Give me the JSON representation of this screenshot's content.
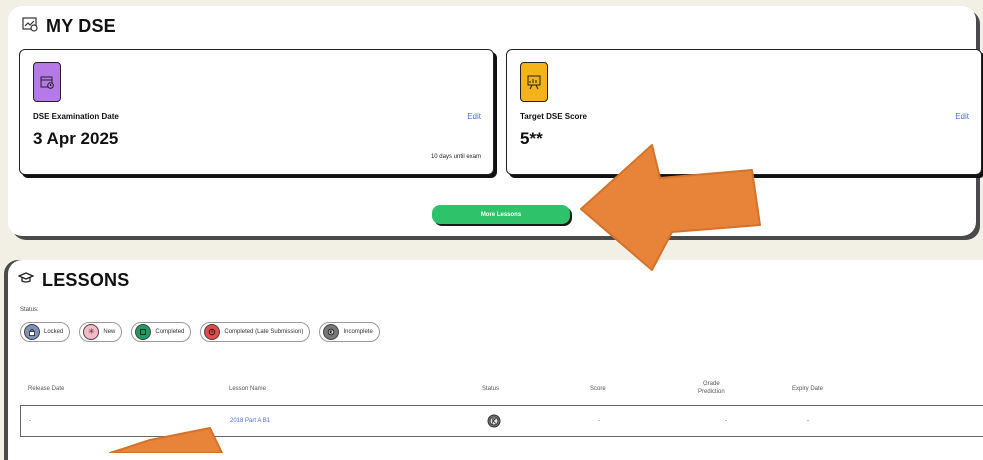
{
  "dse": {
    "title": "MY DSE",
    "exam_card": {
      "label": "DSE Examination Date",
      "value": "3 Apr 2025",
      "edit": "Edit",
      "note": "10 days until exam"
    },
    "target_card": {
      "label": "Target DSE Score",
      "value": "5**",
      "edit": "Edit"
    },
    "more_button": "More Lessons"
  },
  "lessons": {
    "title": "LESSONS",
    "status_label": "Status:",
    "legend": [
      {
        "label": "Locked",
        "color": "#7f8fb8",
        "icon": "lock-icon"
      },
      {
        "label": "New",
        "color": "#f7b8c8",
        "icon": "sun-icon"
      },
      {
        "label": "Completed",
        "color": "#1f9c62",
        "icon": "check-icon"
      },
      {
        "label": "Completed (Late Submission)",
        "color": "#e24b4b",
        "icon": "clock-icon"
      },
      {
        "label": "Incomplete",
        "color": "#777777",
        "icon": "incomplete-icon"
      }
    ],
    "columns": {
      "release_date": "Release Date",
      "lesson_name": "Lesson Name",
      "status": "Status",
      "score": "Score",
      "grade_prediction": "Grade\nPrediction",
      "expiry_date": "Expiry Date"
    },
    "rows": [
      {
        "release_date": "-",
        "lesson_name": "2018 Part A B1",
        "status_icon": "incomplete-icon",
        "score": "-",
        "grade_prediction": "-",
        "expiry_date": "-"
      }
    ]
  },
  "colors": {
    "accent_green": "#2ec26a",
    "link_blue": "#4a6ee0",
    "arrow_orange": "#e8843a"
  }
}
